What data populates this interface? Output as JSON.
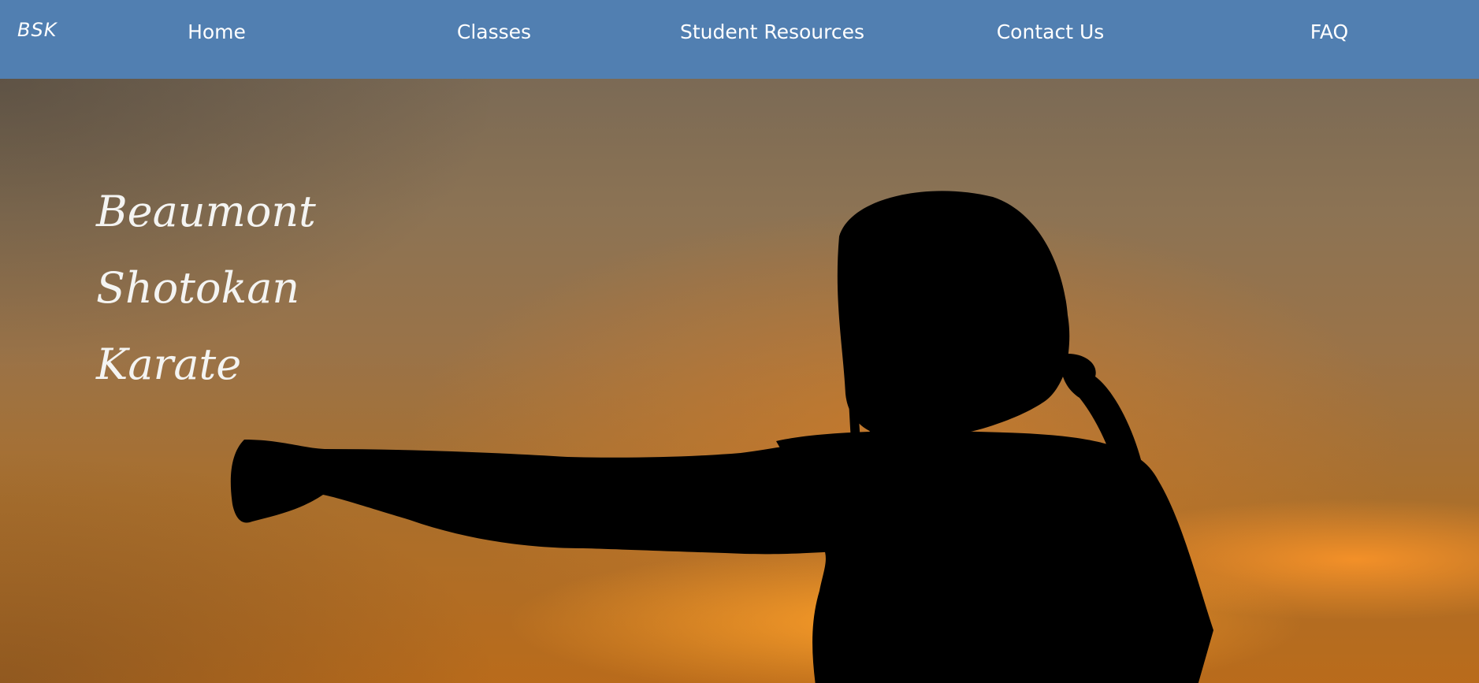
{
  "nav": {
    "logo": "BSK",
    "links": [
      "Home",
      "Classes",
      "Student Resources",
      "Contact Us",
      "FAQ"
    ]
  },
  "hero": {
    "title_lines": [
      "Beaumont",
      "Shotokan",
      "Karate"
    ]
  },
  "colors": {
    "navbar": "#517fb1",
    "nav_text": "#ffffff",
    "hero_text": "#f4f4f2",
    "sunset_orange": "#ff9d2a",
    "silhouette": "#000000"
  }
}
